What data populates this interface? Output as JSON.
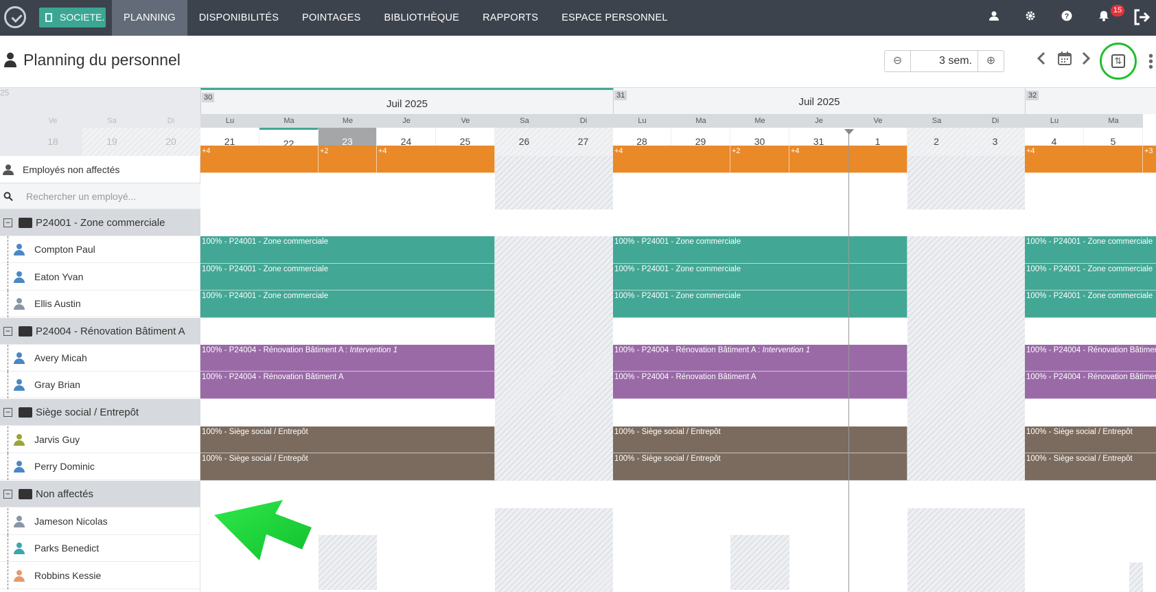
{
  "topbar": {
    "company": "SOCIETE.",
    "nav": [
      "PLANNING",
      "DISPONIBILITÉS",
      "POINTAGES",
      "BIBLIOTHÈQUE",
      "RAPPORTS",
      "ESPACE PERSONNEL"
    ],
    "active": "PLANNING",
    "notifications": "15"
  },
  "header": {
    "title": "Planning du personnel",
    "zoom_value": "3 sem.",
    "zoom_minus": "⊖",
    "zoom_plus": "⊕"
  },
  "left": {
    "prev_week": "25",
    "prev_days": [
      {
        "n": "Ve",
        "d": "18"
      },
      {
        "n": "Sa",
        "d": "19"
      },
      {
        "n": "Di",
        "d": "20"
      }
    ],
    "unassigned_label": "Employés non affectés",
    "search_placeholder": "Rechercher un employé...",
    "rows": [
      {
        "type": "group",
        "label": "P24001 - Zone commerciale"
      },
      {
        "type": "emp",
        "label": "Compton Paul",
        "color": "#4a87c4"
      },
      {
        "type": "emp",
        "label": "Eaton Yvan",
        "color": "#4a87c4"
      },
      {
        "type": "emp",
        "label": "Ellis Austin",
        "color": "#8a96a6"
      },
      {
        "type": "group",
        "label": "P24004 - Rénovation Bâtiment A"
      },
      {
        "type": "emp",
        "label": "Avery Micah",
        "color": "#4a87c4"
      },
      {
        "type": "emp",
        "label": "Gray Brian",
        "color": "#4a87c4"
      },
      {
        "type": "group",
        "label": "Siège social / Entrepôt"
      },
      {
        "type": "emp",
        "label": "Jarvis Guy",
        "color": "#9aa43a"
      },
      {
        "type": "emp",
        "label": "Perry Dominic",
        "color": "#4a87c4"
      },
      {
        "type": "group",
        "label": "Non affectés"
      },
      {
        "type": "emp",
        "label": "Jameson Nicolas",
        "color": "#8a96a6"
      },
      {
        "type": "emp",
        "label": "Parks Benedict",
        "color": "#3aa6b0"
      },
      {
        "type": "emp",
        "label": "Robbins Kessie",
        "color": "#e39a70"
      }
    ]
  },
  "weeks": [
    {
      "num": "30",
      "month": "Juil 2025"
    },
    {
      "num": "31",
      "month": "Juil 2025"
    },
    {
      "num": "32",
      "month": ""
    }
  ],
  "days": [
    {
      "n": "Lu",
      "d": "21"
    },
    {
      "n": "Ma",
      "d": "22"
    },
    {
      "n": "Me",
      "d": "23",
      "today": true
    },
    {
      "n": "Je",
      "d": "24"
    },
    {
      "n": "Ve",
      "d": "25"
    },
    {
      "n": "Sa",
      "d": "26",
      "we": true
    },
    {
      "n": "Di",
      "d": "27",
      "we": true
    },
    {
      "n": "Lu",
      "d": "28"
    },
    {
      "n": "Ma",
      "d": "29"
    },
    {
      "n": "Me",
      "d": "30"
    },
    {
      "n": "Je",
      "d": "31"
    },
    {
      "n": "Ve",
      "d": "1"
    },
    {
      "n": "Sa",
      "d": "2",
      "we": true
    },
    {
      "n": "Di",
      "d": "3",
      "we": true
    },
    {
      "n": "Lu",
      "d": "4"
    },
    {
      "n": "Ma",
      "d": "5"
    }
  ],
  "unassigned_counts": [
    {
      "w": 0,
      "items": [
        "+4",
        "+2",
        "+4"
      ]
    },
    {
      "w": 1,
      "items": [
        "+4",
        "+2",
        "+4"
      ]
    },
    {
      "w": 2,
      "items": [
        "+4",
        "+3"
      ]
    }
  ],
  "bars": {
    "zone": "100% - P24001 - Zone commerciale",
    "renov": "100% - P24004 - Rénovation Bâtiment A",
    "renov_intervention": "100% - P24004 - Rénovation Bâtiment A : ",
    "intervention": "Intervention 1",
    "siege": "100% - Siège social / Entrepôt"
  }
}
